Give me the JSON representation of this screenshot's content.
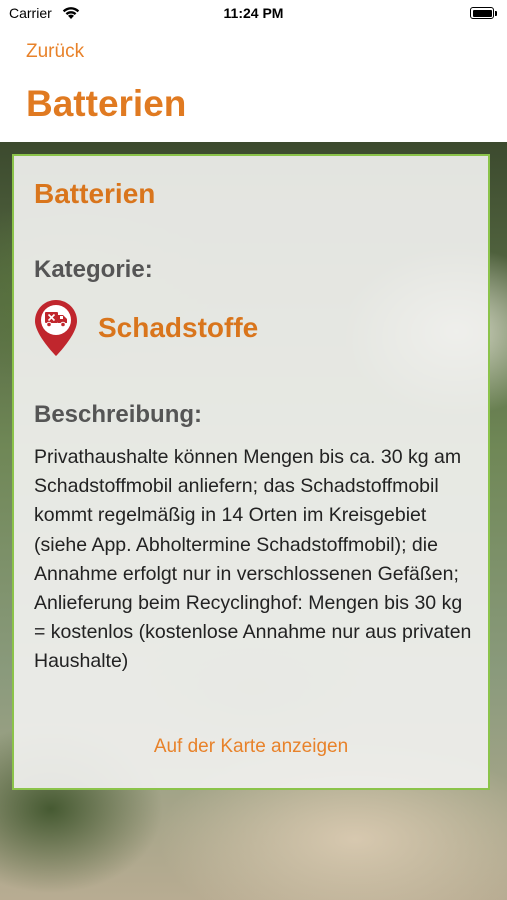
{
  "status_bar": {
    "carrier": "Carrier",
    "time": "11:24 PM",
    "wifi_icon": "wifi-icon",
    "battery_icon": "battery-icon"
  },
  "nav": {
    "back_label": "Zurück",
    "title": "Batterien"
  },
  "card": {
    "title": "Batterien",
    "category_heading": "Kategorie:",
    "category_icon": "hazardous-waste-pin-icon",
    "category_value": "Schadstoffe",
    "description_heading": "Beschreibung:",
    "description_text": "Privathaushalte können Mengen bis ca. 30 kg am Schadstoffmobil anliefern; das Schadstoffmobil kommt regelmäßig in 14 Orten im Kreisgebiet (siehe App. Abholtermine Schadstoffmobil); die Annahme erfolgt nur in verschlossenen Gefäßen; Anlieferung beim Recyclinghof: Mengen bis 30 kg = kostenlos (kostenlose Annahme nur aus privaten Haushalte)",
    "map_link_label": "Auf der Karte anzeigen"
  },
  "colors": {
    "accent_orange": "#e07a21",
    "card_border_green": "#8bc34a",
    "pin_red": "#c0262d"
  }
}
